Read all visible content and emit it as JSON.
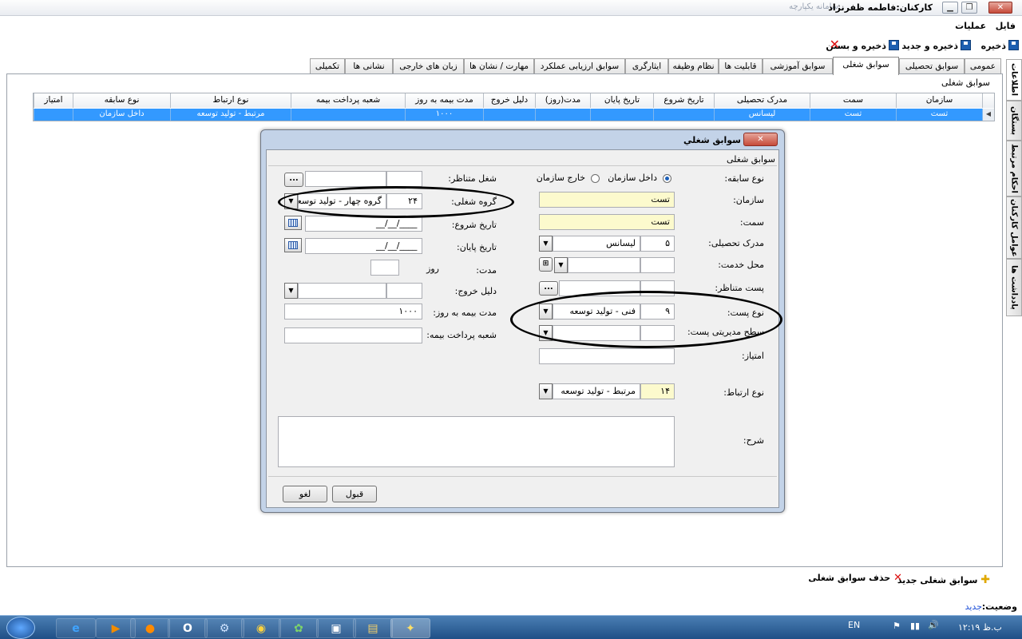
{
  "window": {
    "title": "کارکنان:فاطمه ظفرنژاد",
    "faint_title": "سامانه یکپارچه"
  },
  "menu": {
    "items": [
      "فایل",
      "عملیات"
    ]
  },
  "toolbar": {
    "save": "ذخیره",
    "save_new": "ذخیره و جدید",
    "save_close": "ذخیره و بستن"
  },
  "side_tabs": [
    "اطلاعات",
    "بستگان",
    "احکام مرتبط",
    "عوامل کارکنان",
    "یادداشت ها"
  ],
  "tabs": [
    "عمومی",
    "سوابق تحصیلی",
    "سوابق شغلی",
    "سوابق آموزشی",
    "قابلیت ها",
    "نظام وظیفه",
    "ایثارگری",
    "سوابق ارزیابی عملکرد",
    "مهارت / نشان ها",
    "زبان های خارجی",
    "نشانی ها",
    "تکمیلی"
  ],
  "section_title": "سوابق شغلی",
  "grid": {
    "headers": [
      "سازمان",
      "سمت",
      "مدرک تحصیلی",
      "تاریخ شروع",
      "تاریخ پایان",
      "مدت(روز)",
      "دلیل خروج",
      "مدت بیمه به روز",
      "شعبه پرداخت بیمه",
      "نوع ارتباط",
      "نوع سابقه",
      "امتیاز"
    ],
    "row": [
      "تست",
      "تست",
      "لیسانس",
      "",
      "",
      "",
      "",
      "۱۰۰۰",
      "",
      "مرتبط - تولید توسعه",
      "داخل سازمان",
      ""
    ]
  },
  "dialog": {
    "title": "سوابق شغلي",
    "group_title": "سوابق شغلی",
    "labels": {
      "record_type": "نوع سابقه:",
      "organization": "سازمان:",
      "position": "سمت:",
      "degree": "مدرک تحصیلی:",
      "service_place": "محل خدمت:",
      "equiv_post": "پست متناظر:",
      "post_type": "نوع پست:",
      "mgmt_level": "سطح مدیریتی پست:",
      "score": "امتیاز:",
      "relation_type": "نوع ارتباط:",
      "description": "شرح:",
      "equiv_job": "شغل متناظر:",
      "job_group": "گروه شغلی:",
      "start_date": "تاریخ شروع:",
      "end_date": "تاریخ پایان:",
      "duration": "مدت:",
      "days": "روز",
      "exit_reason": "دلیل خروج:",
      "insurance_days": "مدت بیمه به روز:",
      "insurance_branch": "شعبه پرداخت بیمه:"
    },
    "radio_inside": "داخل سازمان",
    "radio_outside": "خارج سازمان",
    "values": {
      "organization": "تست",
      "position": "تست",
      "degree_code": "۵",
      "degree_name": "لیسانس",
      "post_type_code": "۹",
      "post_type_name": "فنی - تولید توسعه",
      "relation_code": "۱۴",
      "relation_name": "مرتبط - تولید توسعه",
      "job_group_code": "۲۴",
      "job_group_name": "گروه چهار - تولید توسعه",
      "start_date": "__/__/____",
      "end_date": "__/__/____",
      "insurance_days": "۱۰۰۰"
    },
    "ok": "قبول",
    "cancel": "لغو"
  },
  "bottom": {
    "add": "سوابق شغلی جدید",
    "delete": "حذف سوابق شغلی"
  },
  "status": {
    "label": "وضعیت:",
    "value": "جدید"
  },
  "taskbar": {
    "lang": "EN",
    "clock": "ب.ظ ۱۲:۱۹"
  }
}
